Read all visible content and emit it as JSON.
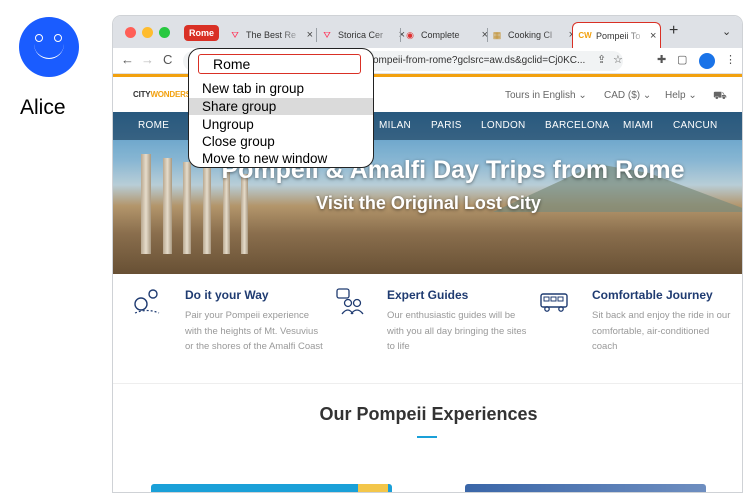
{
  "user": {
    "name": "Alice",
    "avatar_color": "#1a5cff"
  },
  "browser": {
    "group_label": "Rome",
    "tabs": [
      {
        "title": "The Best Re",
        "icon": "airbnb-icon",
        "icon_glyph": "⛛",
        "icon_color": "#ff385c"
      },
      {
        "title": "Storica Cer",
        "icon": "airbnb-icon",
        "icon_glyph": "⛛",
        "icon_color": "#ff385c"
      },
      {
        "title": "Complete",
        "icon": "record-icon",
        "icon_glyph": "◉",
        "icon_color": "#e03030"
      },
      {
        "title": "Cooking Cl",
        "icon": "image-icon",
        "icon_glyph": "▦",
        "icon_color": "#c08a20"
      },
      {
        "title": "Pompeii To",
        "icon": "citywonders-icon",
        "icon_glyph": "CW",
        "icon_color": "#f2a10f"
      }
    ],
    "close_glyph": "×",
    "new_tab_glyph": "+",
    "tab_menu_glyph": "⌄",
    "url": "ompeii-from-rome?gclsrc=aw.ds&gclid=Cj0KC...",
    "nav": {
      "back": "←",
      "forward": "→",
      "reload": "C"
    }
  },
  "context_menu": {
    "group_name_value": "Rome",
    "items": [
      "New tab in group",
      "Share group",
      "Ungroup",
      "Close group",
      "Move to new window"
    ],
    "highlighted": "Share group"
  },
  "site": {
    "logo_prefix": "CITY",
    "logo_suffix": "WONDERS",
    "header_links": [
      "Tours in English",
      "CAD ($)",
      "Help"
    ],
    "cart_glyph": "🛒",
    "menu": [
      "ROME",
      "MILAN",
      "PARIS",
      "LONDON",
      "BARCELONA",
      "MIAMI",
      "CANCUN"
    ],
    "hero_title": "Pompeii & Amalfi Day Trips from Rome",
    "hero_subtitle": "Visit the Original Lost City",
    "features": [
      {
        "title": "Do it your Way",
        "desc": "Pair your Pompeii experience with the heights of Mt. Vesuvius or the shores of the Amalfi Coast",
        "icon": "map-pin-icon"
      },
      {
        "title": "Expert Guides",
        "desc": "Our enthusiastic guides will be with you all day bringing the sites to life",
        "icon": "people-icon"
      },
      {
        "title": "Comfortable Journey",
        "desc": "Sit back and enjoy the ride in our comfortable, air-conditioned coach",
        "icon": "bus-icon"
      }
    ],
    "section_title": "Our Pompeii Experiences"
  }
}
